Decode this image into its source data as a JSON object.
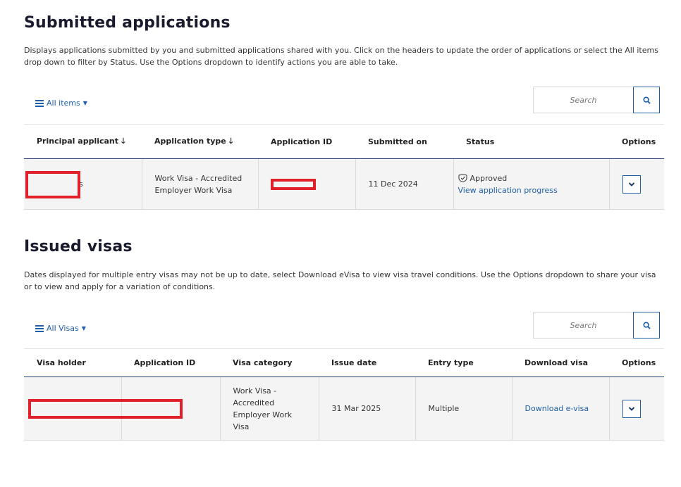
{
  "submitted": {
    "title": "Submitted applications",
    "description": "Displays applications submitted by you and submitted applications shared with you. Click on the headers to update the order of applications or select the All items drop down to filter by Status. Use the Options dropdown to identify actions you are able to take.",
    "filter_label": "All items",
    "search_placeholder": "Search",
    "columns": [
      "Principal applicant",
      "Application type",
      "Application ID",
      "Submitted on",
      "Status",
      "Options"
    ],
    "rows": [
      {
        "principal": "s",
        "type": "Work Visa - Accredited Employer Work Visa",
        "application_id": "",
        "submitted_on": "11 Dec 2024",
        "status": "Approved",
        "status_link": "View application progress"
      }
    ]
  },
  "issued": {
    "title": "Issued visas",
    "description": "Dates displayed for multiple entry visas may not be up to date, select Download eVisa to view visa travel conditions. Use the Options dropdown to share your visa or to view and apply for a variation of conditions.",
    "filter_label": "All Visas",
    "search_placeholder": "Search",
    "columns": [
      "Visa holder",
      "Application ID",
      "Visa category",
      "Issue date",
      "Entry type",
      "Download visa",
      "Options"
    ],
    "rows": [
      {
        "holder": "",
        "application_id": "",
        "category": "Work Visa - Accredited Employer Work Visa",
        "issue_date": "31 Mar 2025",
        "entry_type": "Multiple",
        "download": "Download e-visa"
      }
    ]
  },
  "colors": {
    "accent": "#1f5fa8",
    "redaction": "#e0202a",
    "header_rule": "#1f3e6e"
  },
  "icons": {
    "filter": "list-icon",
    "search": "search-icon",
    "options": "chevron-down-icon",
    "status": "shield-check-icon"
  }
}
